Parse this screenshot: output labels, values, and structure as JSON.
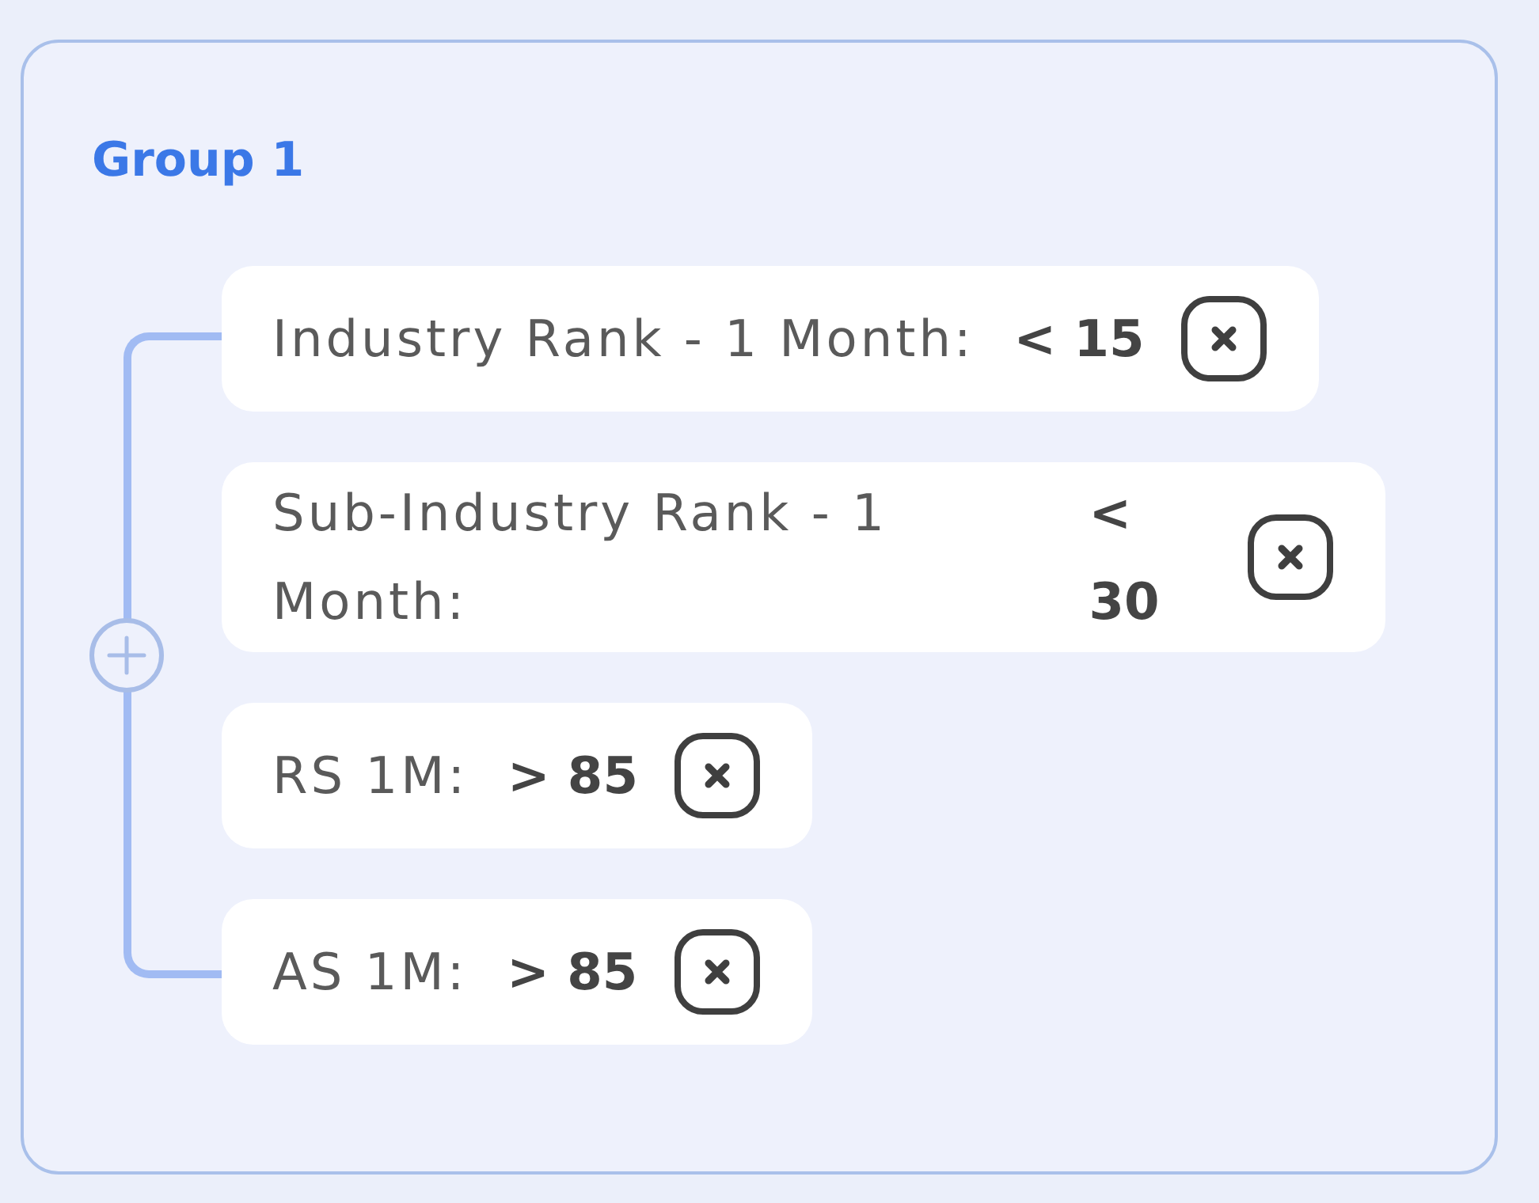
{
  "group": {
    "title": "Group 1",
    "conditions": [
      {
        "label": "Industry Rank - 1 Month:",
        "value": "< 15"
      },
      {
        "label": "Sub-Industry Rank - 1 Month:",
        "value": "< 30"
      },
      {
        "label": "RS 1M:",
        "value": "> 85"
      },
      {
        "label": "AS 1M:",
        "value": "> 85"
      }
    ]
  }
}
